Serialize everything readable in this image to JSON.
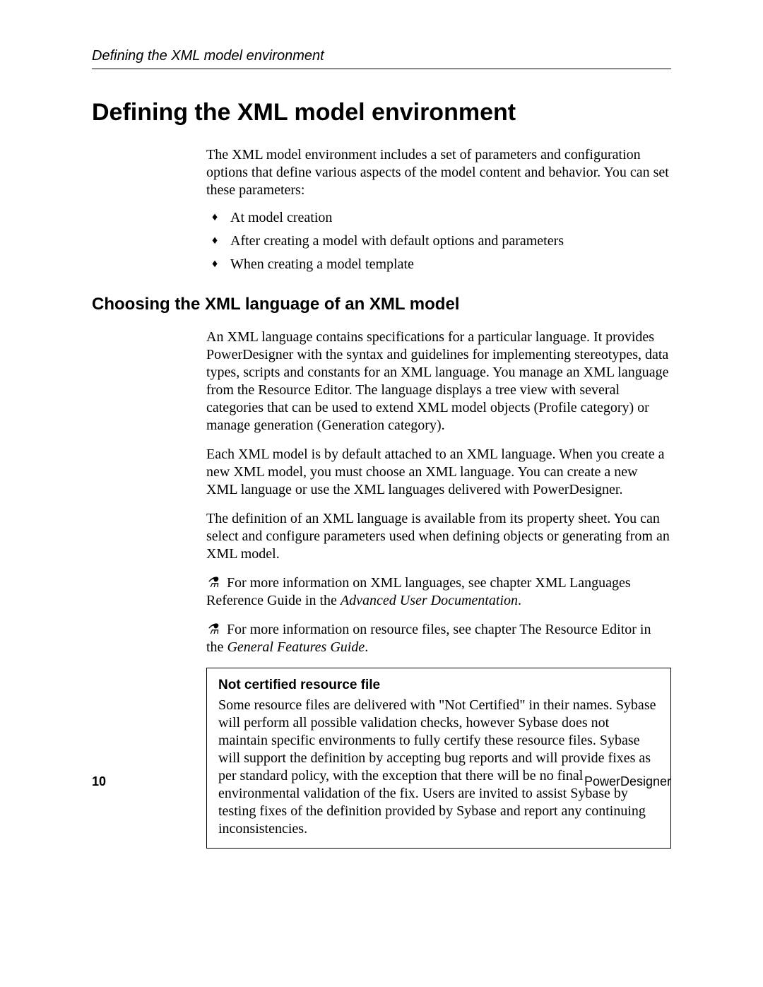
{
  "header": {
    "running_title": "Defining the XML model environment"
  },
  "title": "Defining the XML model environment",
  "intro": "The XML model environment includes a set of parameters and configuration options that define various aspects of the model content and behavior. You can set these parameters:",
  "bullets": [
    "At model creation",
    "After creating a model with default options and parameters",
    "When creating a model template"
  ],
  "section": {
    "heading": "Choosing the XML language of an XML model",
    "p1": "An XML language contains specifications for a particular language. It provides PowerDesigner with the syntax and guidelines for implementing stereotypes, data types, scripts and constants for an XML language. You manage an XML language from the Resource Editor. The language displays a tree view with several categories that can be used to extend XML model objects (Profile category) or manage generation (Generation category).",
    "p2": "Each XML model is by default attached to an XML language. When you create a new XML model, you must choose an XML language. You can create a new XML language or use the XML languages delivered with PowerDesigner.",
    "p3": "The definition of an XML language is available from its property sheet. You can select and configure parameters used when defining objects or generating from an XML model.",
    "note1_lead": "For more information on XML languages, see chapter XML Languages Reference Guide in the ",
    "note1_ital": "Advanced User Documentation",
    "note1_tail": ".",
    "note2_lead": "For more information on resource files, see chapter The Resource Editor in the ",
    "note2_ital": "General Features Guide",
    "note2_tail": ".",
    "box": {
      "title": "Not certified resource file",
      "body": "Some resource files are delivered with \"Not Certified\" in their names. Sybase will perform all possible validation checks, however Sybase does not maintain specific environments to fully certify these resource files. Sybase will support the definition by accepting bug reports and will provide fixes as per standard policy, with the exception that there will be no final environmental validation of the fix.  Users are invited to assist Sybase by testing fixes of the definition provided by Sybase and report any continuing inconsistencies."
    }
  },
  "footer": {
    "page_number": "10",
    "product": "PowerDesigner"
  },
  "icons": {
    "glasses": "⚗"
  }
}
